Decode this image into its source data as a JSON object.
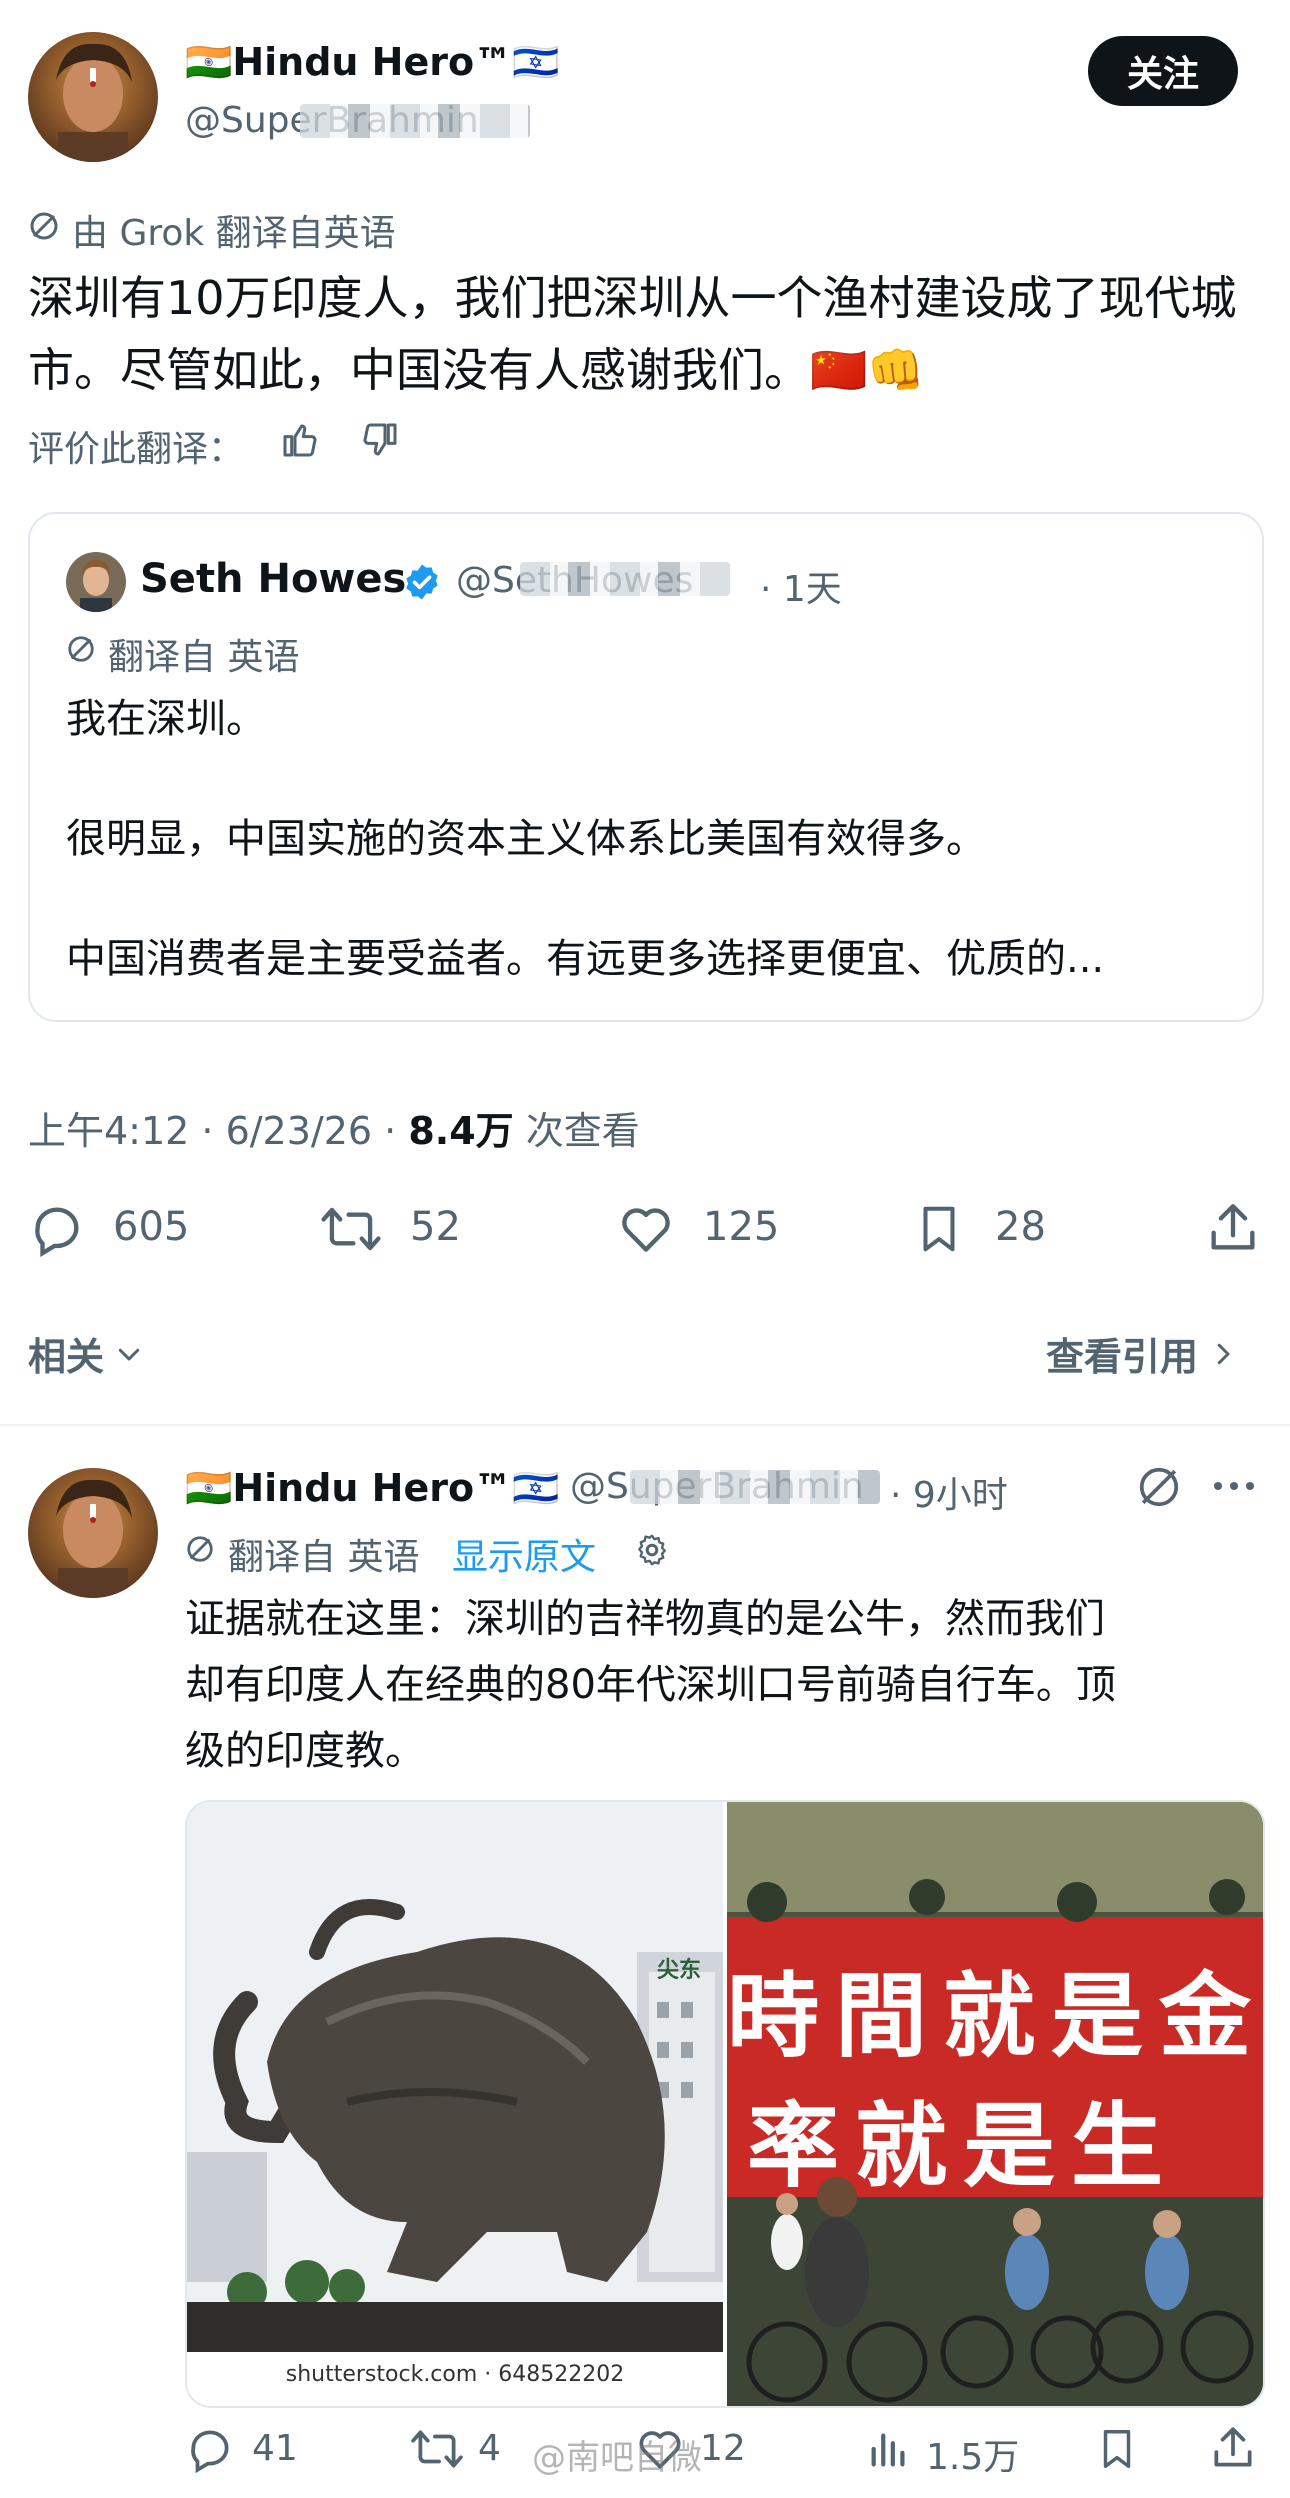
{
  "main_tweet": {
    "display_name": "🇮🇳Hindu Hero™🇮🇱",
    "handle": "@SuperBrahmin",
    "follow_label": "关注",
    "translation_note": "由 Grok 翻译自英语",
    "text": "深圳有10万印度人，我们把深圳从一个渔村建设成了现代城市。尽管如此，中国没有人感谢我们。🇨🇳👊",
    "rate_translation_label": "评价此翻译：",
    "time": "上午4:12 · 6/23/26 · ",
    "views_count": "8.4万",
    "views_label": " 次查看",
    "actions": {
      "replies": "605",
      "retweets": "52",
      "likes": "125",
      "bookmarks": "28"
    },
    "related_label": "相关",
    "quotes_label": "查看引用"
  },
  "quoted_tweet": {
    "display_name": "Seth Howes",
    "handle": "@SethHowes",
    "time": "· 1天",
    "translation_note": "翻译自 英语",
    "line1": "我在深圳。",
    "line2": "很明显，中国实施的资本主义体系比美国有效得多。",
    "line3": "中国消费者是主要受益者。有远更多选择更便宜、优质的..."
  },
  "reply_tweet": {
    "display_name": "🇮🇳Hindu Hero™🇮🇱",
    "handle": "@SuperBrahmin",
    "time": "· 9小时",
    "translation_note": "翻译自 英语",
    "show_original": "显示原文",
    "line1": "证据就在这里：深圳的吉祥物真的是公牛，然而我们",
    "line2": "却有印度人在经典的80年代深圳口号前骑自行车。顶",
    "line3": "级的印度教。",
    "image1_caption": "shutterstock.com · 648522202",
    "image1_sign": "尖东",
    "image2_slogan_line1": "時間就是金",
    "image2_slogan_line2": "率就是生",
    "actions": {
      "replies": "41",
      "retweets": "4",
      "likes": "12",
      "views": "1.5万"
    }
  },
  "watermark": "@南吧自微",
  "colors": {
    "accent_blue": "#1d9bf0",
    "text": "#0f1419",
    "secondary": "#536471",
    "border": "#e1e8ed"
  },
  "icons": [
    "translate-icon",
    "thumbs-up-icon",
    "thumbs-down-icon",
    "verified-badge-icon",
    "reply-icon",
    "retweet-icon",
    "like-icon",
    "bookmark-icon",
    "share-icon",
    "chevron-down-icon",
    "chevron-right-icon",
    "more-icon",
    "settings-gear-icon",
    "views-chart-icon",
    "grok-icon"
  ]
}
